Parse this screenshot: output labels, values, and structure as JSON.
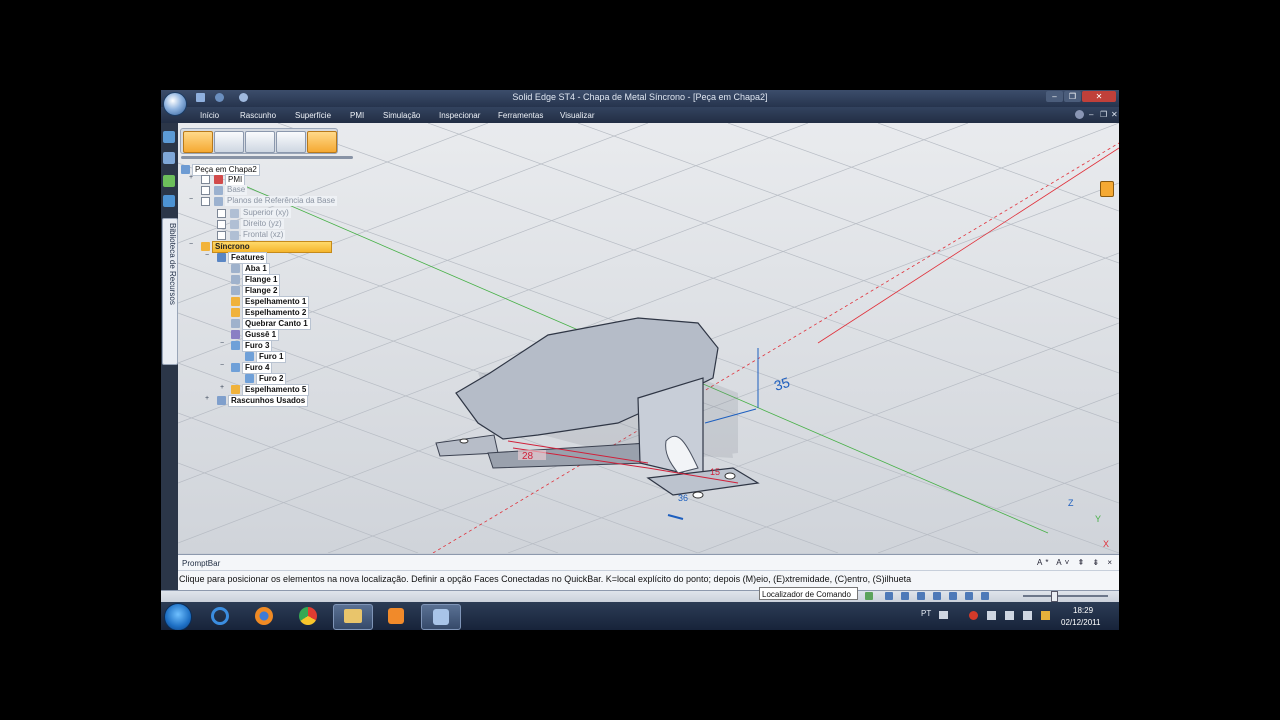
{
  "window": {
    "title": "Solid Edge ST4 - Chapa de Metal Síncrono - [Peça em Chapa2]"
  },
  "menu": [
    "Início",
    "Rascunho",
    "Superfície",
    "PMI",
    "Simulação",
    "Inspecionar",
    "Ferramentas",
    "Visualizar"
  ],
  "resource_tab": "Biblioteca de Recursos",
  "tree": {
    "root": "Peça em Chapa2",
    "pmi": "PMI",
    "base": "Base",
    "ref_planes": "Planos de Referência da Base",
    "plane_top": "Superior (xy)",
    "plane_right": "Direito (yz)",
    "plane_front": "Frontal (xz)",
    "sync": "Síncrono",
    "features": "Features",
    "aba1": "Aba 1",
    "flange1": "Flange 1",
    "flange2": "Flange 2",
    "mirror1": "Espelhamento 1",
    "mirror2": "Espelhamento 2",
    "corner1": "Quebrar Canto 1",
    "gusset1": "Gussê 1",
    "hole3": "Furo 3",
    "hole1": "Furo 1",
    "hole4": "Furo 4",
    "hole2": "Furo 2",
    "mirror5": "Espelhamento 5",
    "sketches": "Rascunhos Usados"
  },
  "dimensions": {
    "height": "35",
    "left": "28",
    "small1": "15",
    "small2": "36"
  },
  "triad": {
    "z": "Z",
    "y": "Y",
    "x": "X"
  },
  "promptbar": {
    "title": "PromptBar",
    "message": "Clique para posicionar os elementos na nova localização. Definir a opção Faces Conectadas no QuickBar. K=local explícito do ponto; depois (M)eio, (E)xtremidade, (C)entro, (S)ilhueta",
    "controls": "A* A˅ ⇞ ⇟ ×"
  },
  "status": {
    "command_finder": "Localizador de Comando"
  },
  "taskbar": {
    "lang": "PT",
    "time": "18:29",
    "date": "02/12/2011"
  },
  "icons": {
    "app_menu": "solid-edge-orb-icon",
    "save": "save-icon",
    "undo": "undo-icon",
    "redo": "redo-icon",
    "lock": "lock-icon"
  },
  "colors": {
    "accent_orange": "#f5a933",
    "axis_red": "#e0303a",
    "axis_green": "#46b046",
    "dim_blue": "#1d5fbf",
    "dim_red": "#d0203a"
  }
}
